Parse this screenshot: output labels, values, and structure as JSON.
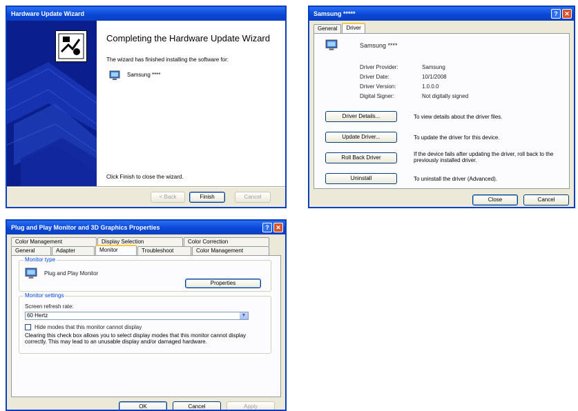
{
  "wizard": {
    "title": "Hardware Update Wizard",
    "heading": "Completing the Hardware Update Wizard",
    "subtext": "The wizard has finished installing the software for:",
    "device_name": "Samsung ****",
    "finish_text": "Click Finish to close the wizard.",
    "buttons": {
      "back": "< Back",
      "finish": "Finish",
      "cancel": "Cancel"
    }
  },
  "driver_props": {
    "title": "Samsung *****",
    "tabs": [
      "General",
      "Driver"
    ],
    "active_tab": "Driver",
    "device_name": "Samsung ****",
    "fields": [
      {
        "label": "Driver Provider:",
        "value": "Samsung"
      },
      {
        "label": "Driver Date:",
        "value": "10/1/2008"
      },
      {
        "label": "Driver Version:",
        "value": "1.0.0.0"
      },
      {
        "label": "Digital Signer:",
        "value": "Not digitally signed"
      }
    ],
    "actions": [
      {
        "button": "Driver Details...",
        "desc": "To view details about the driver files."
      },
      {
        "button": "Update Driver...",
        "desc": "To update the driver for this device."
      },
      {
        "button": "Roll Back Driver",
        "desc": "If the device fails after updating the driver, roll back to the previously installed driver."
      },
      {
        "button": "Uninstall",
        "desc": "To uninstall the driver (Advanced)."
      }
    ],
    "buttons": {
      "close": "Close",
      "cancel": "Cancel"
    }
  },
  "display_props": {
    "title": "Plug and Play Monitor and 3D Graphics Properties",
    "tabs_row1": [
      "Color Management",
      "Display Selection",
      "Color Correction"
    ],
    "tabs_row2": [
      "General",
      "Adapter",
      "Monitor",
      "Troubleshoot",
      "Color Management"
    ],
    "active_tab": "Monitor",
    "monitor_type_caption": "Monitor type",
    "monitor_name": "Plug and Play Monitor",
    "properties_button": "Properties",
    "settings_caption": "Monitor settings",
    "refresh_label": "Screen refresh rate:",
    "refresh_value": "60 Hertz",
    "hide_modes_label": "Hide modes that this monitor cannot display",
    "hide_modes_checked": false,
    "hide_modes_help": "Clearing this check box allows you to select display modes that this monitor cannot display correctly. This may lead to an unusable display and/or damaged hardware.",
    "buttons": {
      "ok": "OK",
      "cancel": "Cancel",
      "apply": "Apply"
    }
  }
}
